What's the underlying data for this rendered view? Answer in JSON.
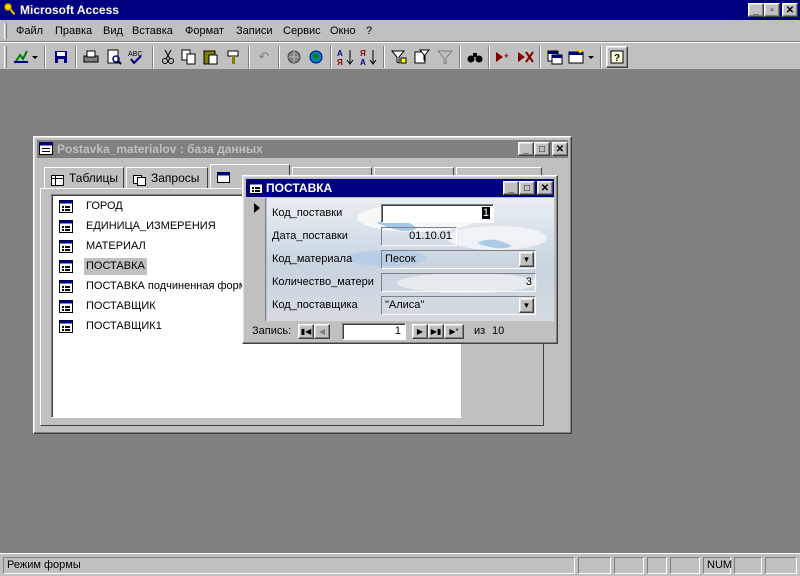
{
  "app": {
    "title": "Microsoft Access"
  },
  "menu": [
    "Файл",
    "Правка",
    "Вид",
    "Вставка",
    "Формат",
    "Записи",
    "Сервис",
    "Окно",
    "?"
  ],
  "toolbar": {
    "icons": [
      "view-icon",
      "save-icon",
      "print-icon",
      "print-preview-icon",
      "spelling-icon",
      "cut-icon",
      "copy-icon",
      "paste-icon",
      "format-painter-icon",
      "undo-icon",
      "insert-hyperlink-icon",
      "web-toolbar-icon",
      "sort-ascending-icon",
      "sort-descending-icon",
      "filter-by-selection-icon",
      "filter-by-form-icon",
      "apply-filter-icon",
      "find-icon",
      "new-record-icon",
      "delete-record-icon",
      "database-window-icon",
      "new-object-icon",
      "help-icon"
    ]
  },
  "db_window": {
    "title": "Postavka_materialov : база данных",
    "tabs": [
      "Таблицы",
      "Запросы"
    ],
    "items": [
      "ГОРОД",
      "ЕДИНИЦА_ИЗМЕРЕНИЯ",
      "МАТЕРИАЛ",
      "ПОСТАВКА",
      "ПОСТАВКА подчиненная форма",
      "ПОСТАВЩИК",
      "ПОСТАВЩИК1"
    ],
    "selected_item": "ПОСТАВКА"
  },
  "form_window": {
    "title": "ПОСТАВКА",
    "fields": [
      {
        "label": "Код_поставки",
        "value": "1"
      },
      {
        "label": "Дата_поставки",
        "value": "01.10.01"
      },
      {
        "label": "Код_материала",
        "value": "Песок"
      },
      {
        "label": "Количество_матери",
        "value": "3"
      },
      {
        "label": "Код_поставщика",
        "value": "\"Алиса\""
      }
    ],
    "nav": {
      "label": "Запись:",
      "current": "1",
      "of_label": "из",
      "total": "10"
    }
  },
  "status": {
    "text": "Режим формы",
    "num": "NUM"
  }
}
